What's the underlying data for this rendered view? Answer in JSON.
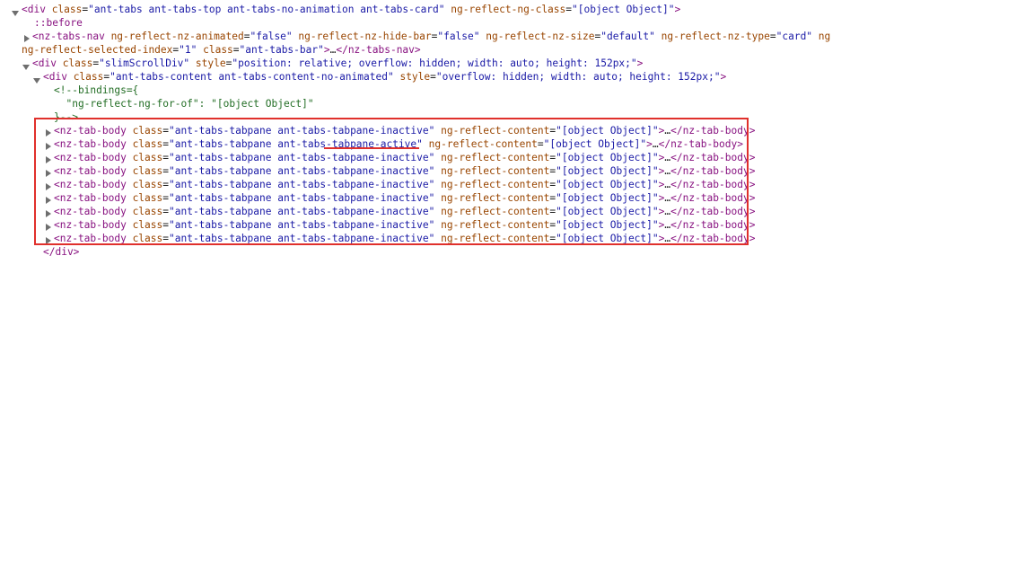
{
  "root_line": {
    "open": "<div ",
    "class_attr": "class",
    "eq": "=",
    "class_val": "\"ant-tabs ant-tabs-top ant-tabs-no-animation ant-tabs-card\"",
    "sp": " ",
    "ng_attr": "ng-reflect-ng-class",
    "ng_val": "\"[object Object]\"",
    "close": ">"
  },
  "before": "::before",
  "nav_line1": {
    "open": "<nz-tabs-nav ",
    "a1": "ng-reflect-nz-animated",
    "v1": "\"false\"",
    "a2": "ng-reflect-nz-hide-bar",
    "v2": "\"false\"",
    "a3": "ng-reflect-nz-size",
    "v3": "\"default\"",
    "a4": "ng-reflect-nz-type",
    "v4": "\"card\"",
    "tail": " ng"
  },
  "nav_line2": {
    "a5": "ng-reflect-selected-index",
    "v5": "\"1\"",
    "a6": "class",
    "v6": "\"ant-tabs-bar\"",
    "close": ">",
    "ellipsis": "…",
    "end": "</nz-tabs-nav>"
  },
  "slim_line": {
    "open": "<div ",
    "a1": "class",
    "v1": "\"slimScrollDiv\"",
    "a2": "style",
    "v2": "\"position: relative; overflow: hidden; width: auto; height: 152px;\"",
    "close": ">"
  },
  "content_line": {
    "open": "<div ",
    "a1": "class",
    "v1": "\"ant-tabs-content ant-tabs-content-no-animated\"",
    "a2": "style",
    "v2": "\"overflow: hidden; width: auto; height: 152px;\"",
    "close": ">"
  },
  "comment": {
    "l1": "<!--bindings={",
    "l2": "  \"ng-reflect-ng-for-of\": \"[object Object]\"",
    "l3": "}-->"
  },
  "tab_bodies": [
    {
      "open": "<nz-tab-body ",
      "class_attr": "class",
      "class_val": "\"ant-tabs-tabpane ant-tabs-tabpane-inactive\"",
      "content_attr": "ng-reflect-content",
      "content_val": "\"[object Object]\"",
      "close": ">",
      "ellipsis": "…",
      "end": "</nz-tab-body>"
    },
    {
      "open": "<nz-tab-body ",
      "class_attr": "class",
      "class_val": "\"ant-tabs-tabpane ant-tabs-tabpane-active\"",
      "content_attr": "ng-reflect-content",
      "content_val": "\"[object Object]\"",
      "close": ">",
      "ellipsis": "…",
      "end": "</nz-tab-body>"
    },
    {
      "open": "<nz-tab-body ",
      "class_attr": "class",
      "class_val": "\"ant-tabs-tabpane ant-tabs-tabpane-inactive\"",
      "content_attr": "ng-reflect-content",
      "content_val": "\"[object Object]\"",
      "close": ">",
      "ellipsis": "…",
      "end": "</nz-tab-body>"
    },
    {
      "open": "<nz-tab-body ",
      "class_attr": "class",
      "class_val": "\"ant-tabs-tabpane ant-tabs-tabpane-inactive\"",
      "content_attr": "ng-reflect-content",
      "content_val": "\"[object Object]\"",
      "close": ">",
      "ellipsis": "…",
      "end": "</nz-tab-body>"
    },
    {
      "open": "<nz-tab-body ",
      "class_attr": "class",
      "class_val": "\"ant-tabs-tabpane ant-tabs-tabpane-inactive\"",
      "content_attr": "ng-reflect-content",
      "content_val": "\"[object Object]\"",
      "close": ">",
      "ellipsis": "…",
      "end": "</nz-tab-body>"
    },
    {
      "open": "<nz-tab-body ",
      "class_attr": "class",
      "class_val": "\"ant-tabs-tabpane ant-tabs-tabpane-inactive\"",
      "content_attr": "ng-reflect-content",
      "content_val": "\"[object Object]\"",
      "close": ">",
      "ellipsis": "…",
      "end": "</nz-tab-body>"
    },
    {
      "open": "<nz-tab-body ",
      "class_attr": "class",
      "class_val": "\"ant-tabs-tabpane ant-tabs-tabpane-inactive\"",
      "content_attr": "ng-reflect-content",
      "content_val": "\"[object Object]\"",
      "close": ">",
      "ellipsis": "…",
      "end": "</nz-tab-body>"
    },
    {
      "open": "<nz-tab-body ",
      "class_attr": "class",
      "class_val": "\"ant-tabs-tabpane ant-tabs-tabpane-inactive\"",
      "content_attr": "ng-reflect-content",
      "content_val": "\"[object Object]\"",
      "close": ">",
      "ellipsis": "…",
      "end": "</nz-tab-body>"
    },
    {
      "open": "<nz-tab-body ",
      "class_attr": "class",
      "class_val": "\"ant-tabs-tabpane ant-tabs-tabpane-inactive\"",
      "content_attr": "ng-reflect-content",
      "content_val": "\"[object Object]\"",
      "close": ">",
      "ellipsis": "…",
      "end": "</nz-tab-body>"
    }
  ],
  "closing_div": "</div>",
  "colors": {
    "tag": "#881280",
    "attr_name": "#994500",
    "attr_value": "#1a1aa6",
    "comment": "#236e25",
    "highlight": "#e0302c"
  }
}
